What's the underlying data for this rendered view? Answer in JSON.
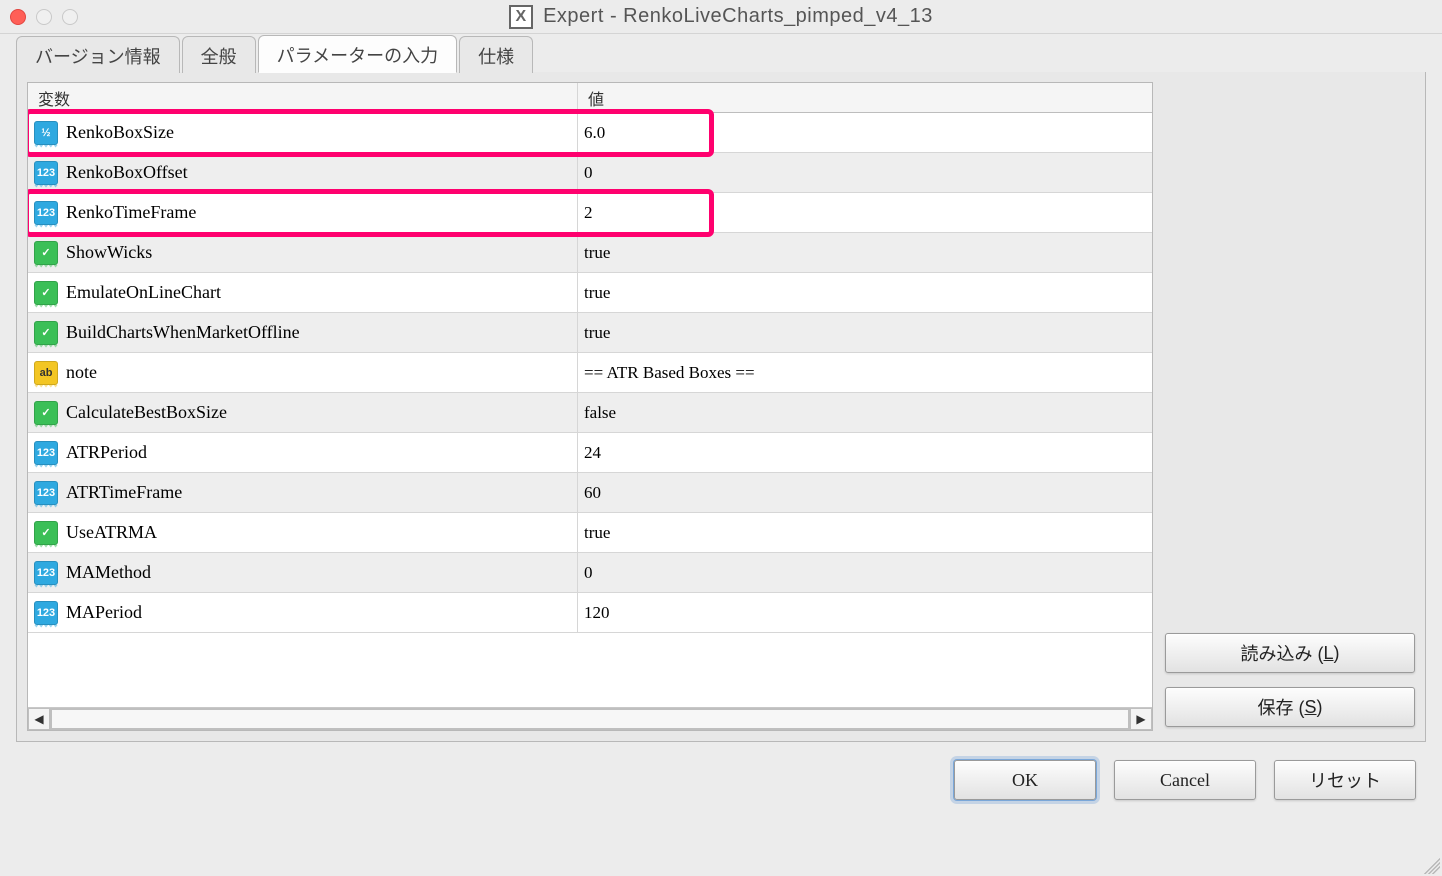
{
  "window": {
    "title": "Expert - RenkoLiveCharts_pimped_v4_13"
  },
  "tabs": [
    {
      "label": "バージョン情報",
      "active": false
    },
    {
      "label": "全般",
      "active": false
    },
    {
      "label": "パラメーターの入力",
      "active": true
    },
    {
      "label": "仕様",
      "active": false
    }
  ],
  "headers": {
    "variable": "変数",
    "value": "値"
  },
  "rows": [
    {
      "type": "double",
      "icon": "½",
      "name": "RenkoBoxSize",
      "value": "6.0",
      "alt": false,
      "highlight": true
    },
    {
      "type": "int",
      "icon": "123",
      "name": "RenkoBoxOffset",
      "value": "0",
      "alt": true,
      "highlight": false
    },
    {
      "type": "int",
      "icon": "123",
      "name": "RenkoTimeFrame",
      "value": "2",
      "alt": false,
      "highlight": true
    },
    {
      "type": "bool",
      "icon": "✓",
      "name": "ShowWicks",
      "value": "true",
      "alt": true,
      "highlight": false
    },
    {
      "type": "bool",
      "icon": "✓",
      "name": "EmulateOnLineChart",
      "value": "true",
      "alt": false,
      "highlight": false
    },
    {
      "type": "bool",
      "icon": "✓",
      "name": "BuildChartsWhenMarketOffline",
      "value": "true",
      "alt": true,
      "highlight": false
    },
    {
      "type": "string",
      "icon": "ab",
      "name": "note",
      "value": "== ATR Based Boxes ==",
      "alt": false,
      "highlight": false
    },
    {
      "type": "bool",
      "icon": "✓",
      "name": "CalculateBestBoxSize",
      "value": "false",
      "alt": true,
      "highlight": false
    },
    {
      "type": "int",
      "icon": "123",
      "name": "ATRPeriod",
      "value": "24",
      "alt": false,
      "highlight": false
    },
    {
      "type": "int",
      "icon": "123",
      "name": "ATRTimeFrame",
      "value": "60",
      "alt": true,
      "highlight": false
    },
    {
      "type": "bool",
      "icon": "✓",
      "name": "UseATRMA",
      "value": "true",
      "alt": false,
      "highlight": false
    },
    {
      "type": "int",
      "icon": "123",
      "name": "MAMethod",
      "value": "0",
      "alt": true,
      "highlight": false
    },
    {
      "type": "int",
      "icon": "123",
      "name": "MAPeriod",
      "value": "120",
      "alt": false,
      "highlight": false
    }
  ],
  "side_buttons": {
    "load": {
      "text": "読み込み (",
      "underline": "L",
      "suffix": ")"
    },
    "save": {
      "text": "保存 (",
      "underline": "S",
      "suffix": ")"
    }
  },
  "bottom_buttons": {
    "ok": "OK",
    "cancel": "Cancel",
    "reset": "リセット"
  }
}
